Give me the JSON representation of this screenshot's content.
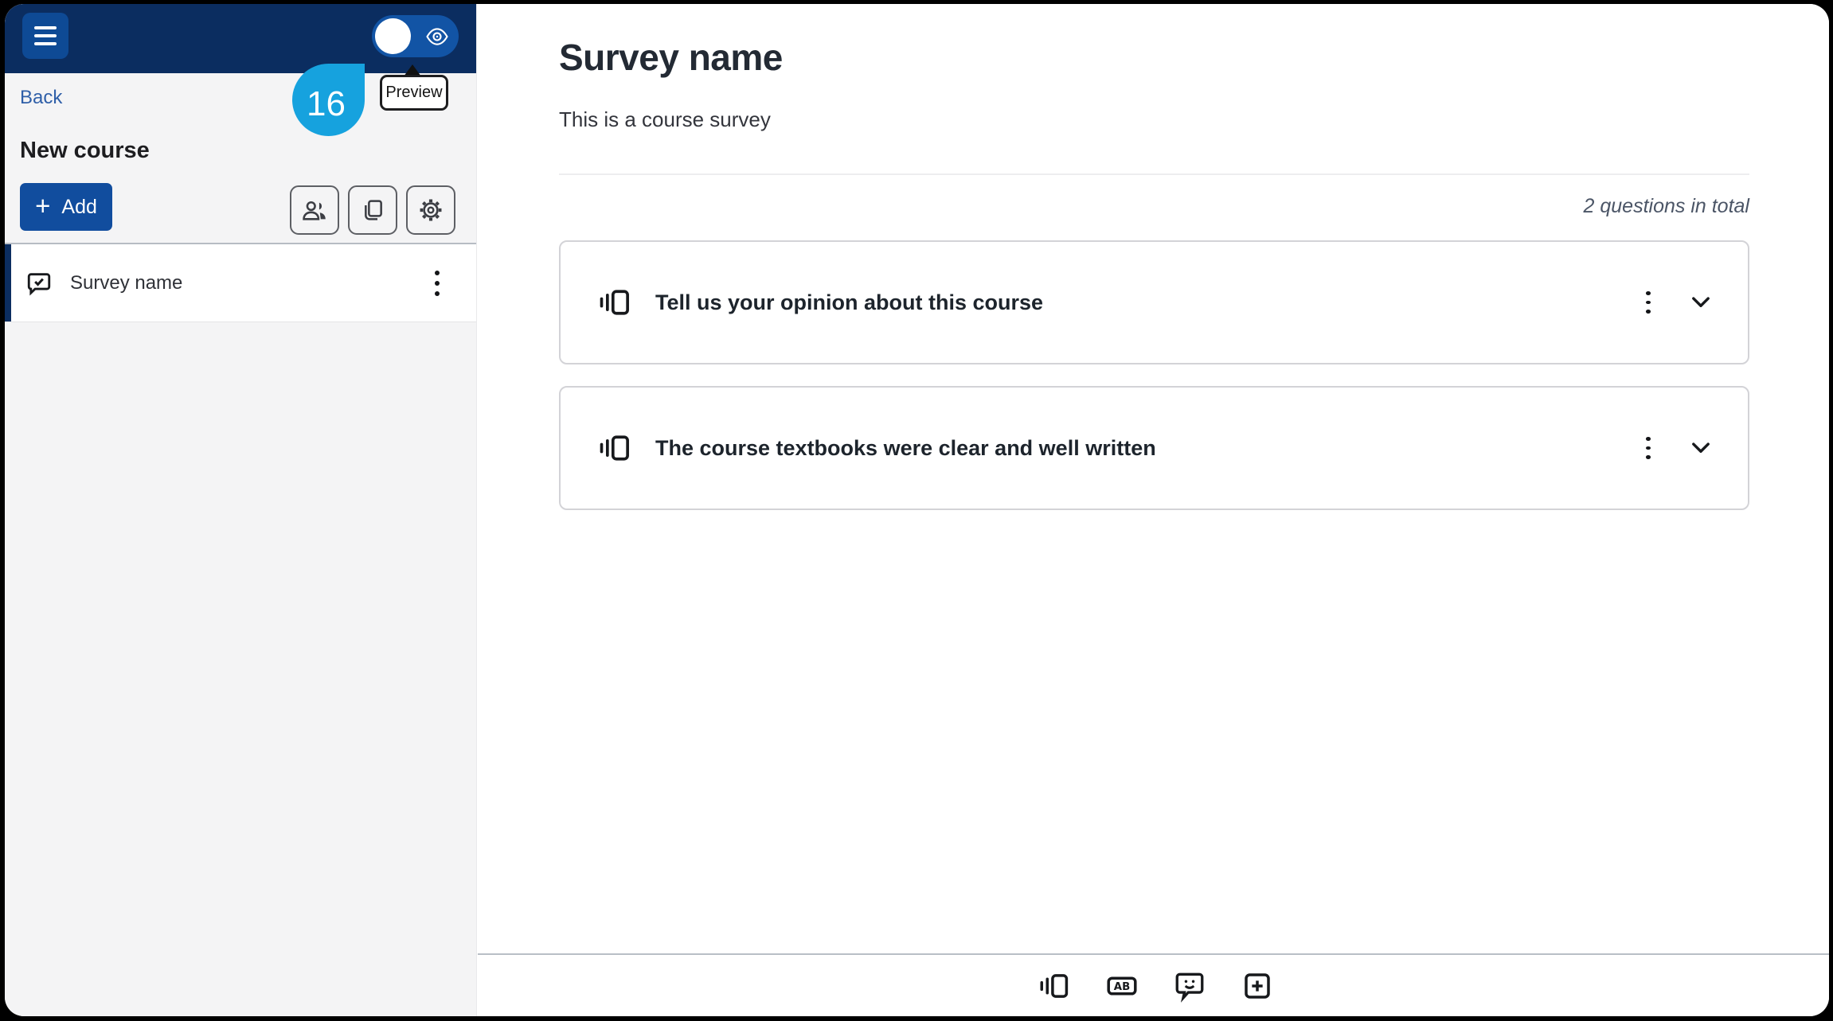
{
  "sidebar": {
    "back_label": "Back",
    "course_title": "New course",
    "add_button": {
      "plus": "+",
      "label": "Add"
    },
    "items": [
      {
        "label": "Survey name"
      }
    ]
  },
  "header_toolbar": {
    "preview_tooltip": "Preview"
  },
  "cursor_badge": {
    "number": "16"
  },
  "main": {
    "title": "Survey name",
    "subtitle": "This is a course survey",
    "questions_total": "2 questions in total",
    "questions": [
      {
        "title": "Tell us your opinion about this course",
        "type_icon": "rating-question-icon"
      },
      {
        "title": "The course textbooks were clear and well written",
        "type_icon": "rating-question-icon"
      }
    ]
  },
  "bottom_toolbar": {
    "icons": [
      "rating-question-icon",
      "multiple-choice-icon",
      "feedback-question-icon",
      "add-question-icon"
    ]
  },
  "colors": {
    "header_navy": "#0b2d60",
    "hamburger_blue": "#0e4a95",
    "toggle_blue": "#1254a5",
    "primary_button_blue": "#114d9e",
    "link_blue": "#2f5fa8",
    "cursor_badge_blue": "#16a2de",
    "sidebar_gray": "#f4f4f5"
  }
}
